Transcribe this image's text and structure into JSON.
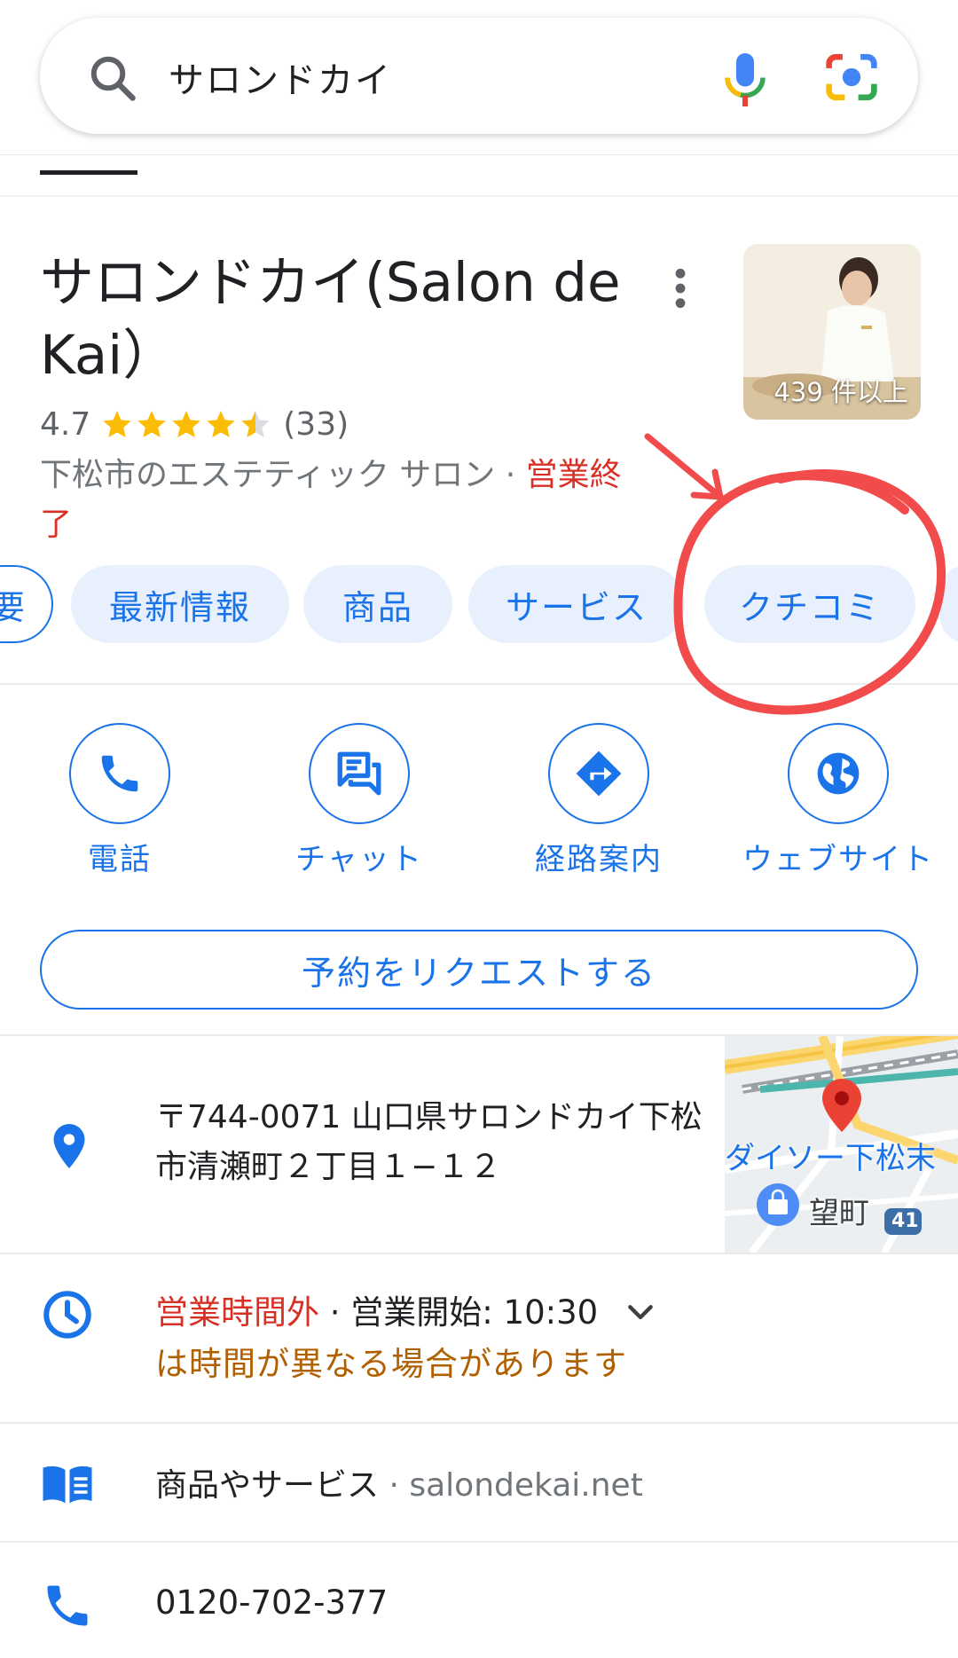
{
  "search": {
    "query": "サロンドカイ"
  },
  "business": {
    "name": "サロンドカイ(Salon de Kai）",
    "rating": "4.7",
    "stars": 4.5,
    "review_count": "(33)",
    "category": "下松市のエステティック サロン · ",
    "status": "営業終了",
    "photo_count": "439 件以上"
  },
  "chips": [
    {
      "label": "要"
    },
    {
      "label": "最新情報"
    },
    {
      "label": "商品"
    },
    {
      "label": "サービス"
    },
    {
      "label": "クチコミ"
    }
  ],
  "actions": [
    {
      "label": "電話",
      "icon": "phone-icon"
    },
    {
      "label": "チャット",
      "icon": "chat-icon"
    },
    {
      "label": "経路案内",
      "icon": "directions-icon"
    },
    {
      "label": "ウェブサイト",
      "icon": "globe-icon"
    }
  ],
  "reserve_label": "予約をリクエストする",
  "address": "〒744-0071 山口県サロンドカイ下松市清瀬町２丁目１−１２",
  "map": {
    "label_daiso": "ダイソー下松末",
    "label_town": "望町",
    "route_badge": "41"
  },
  "hours": {
    "status": "営業時間外",
    "sep": " · ",
    "opens": "営業開始: 10:30",
    "note": "は時間が異なる場合があります"
  },
  "products": {
    "label": "商品やサービス",
    "sep": " · ",
    "site": "salondekai.net"
  },
  "phone": "0120-702-377",
  "colors": {
    "accent": "#1a73e8",
    "chip_bg": "#e8f0fe",
    "closed_red": "#d93025",
    "hours_note": "#b06000",
    "annotation": "#f24b4b"
  }
}
